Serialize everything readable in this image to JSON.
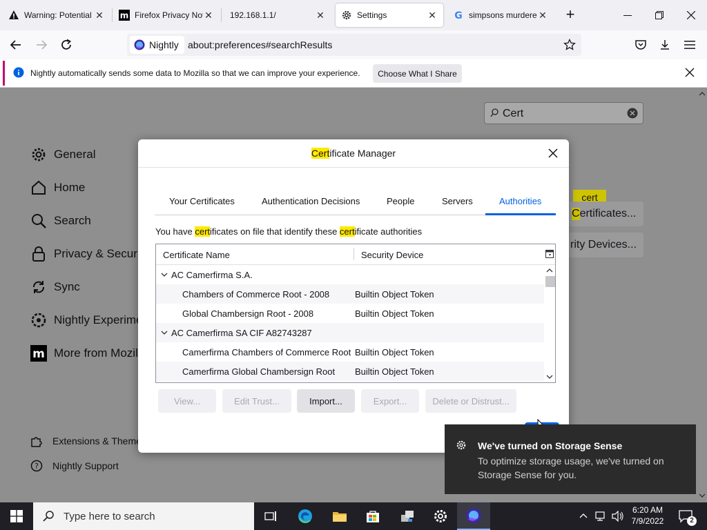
{
  "browser": {
    "tabs": [
      {
        "title": "Warning: Potential",
        "icon": "warning-icon"
      },
      {
        "title": "Firefox Privacy Noti",
        "icon": "mozilla-m-icon"
      },
      {
        "title": "192.168.1.1/",
        "icon": "none"
      },
      {
        "title": "Settings",
        "icon": "gear-icon"
      },
      {
        "title": "simpsons murdered",
        "icon": "google-icon"
      }
    ],
    "new_tab_label": "+",
    "identity_label": "Nightly",
    "url": "about:preferences#searchResults"
  },
  "notification": {
    "message": "Nightly automatically sends some data to Mozilla so that we can improve your experience.",
    "button": "Choose What I Share"
  },
  "settings": {
    "search_value": "Cert",
    "sidebar": [
      {
        "label": "General",
        "icon": "gear-icon"
      },
      {
        "label": "Home",
        "icon": "home-icon"
      },
      {
        "label": "Search",
        "icon": "search-icon"
      },
      {
        "label": "Privacy & Security",
        "icon": "lock-icon"
      },
      {
        "label": "Sync",
        "icon": "sync-icon"
      },
      {
        "label": "Nightly Experime",
        "icon": "experiments-icon"
      },
      {
        "label": "More from Mozill",
        "icon": "mozilla-m-icon"
      }
    ],
    "footer": [
      {
        "label": "Extensions & Theme",
        "icon": "puzzle-icon"
      },
      {
        "label": "Nightly Support",
        "icon": "help-icon"
      }
    ],
    "tooltip": "cert",
    "btn_certificates": "Certificates...",
    "btn_certificates_hl": "C",
    "btn_devices": "rity Devices..."
  },
  "dialog": {
    "title_hl": "Cert",
    "title_rest": "ificate Manager",
    "tabs": [
      "Your Certificates",
      "Authentication Decisions",
      "People",
      "Servers",
      "Authorities"
    ],
    "selected_tab": "Authorities",
    "desc": {
      "p1": "You have ",
      "h1": "cert",
      "p2": "ificates on file that identify these ",
      "h2": "cert",
      "p3": "ificate authorities"
    },
    "columns": [
      "Certificate Name",
      "Security Device"
    ],
    "rows": [
      {
        "type": "group",
        "name": "AC Camerfirma S.A.",
        "device": ""
      },
      {
        "type": "item",
        "name": "Chambers of Commerce Root - 2008",
        "device": "Builtin Object Token"
      },
      {
        "type": "item",
        "name": "Global Chambersign Root - 2008",
        "device": "Builtin Object Token"
      },
      {
        "type": "group",
        "name": "AC Camerfirma SA CIF A82743287",
        "device": ""
      },
      {
        "type": "item",
        "name": "Camerfirma Chambers of Commerce Root",
        "device": "Builtin Object Token"
      },
      {
        "type": "item",
        "name": "Camerfirma Global Chambersign Root",
        "device": "Builtin Object Token"
      }
    ],
    "buttons": {
      "view": "View...",
      "edit_trust": "Edit Trust...",
      "import": "Import...",
      "export": "Export...",
      "delete": "Delete or Distrust..."
    }
  },
  "toast": {
    "title": "We've turned on Storage Sense",
    "body": "To optimize storage usage, we've turned on Storage Sense for you."
  },
  "taskbar": {
    "search_placeholder": "Type here to search",
    "time": "6:20 AM",
    "date": "7/9/2022",
    "notification_count": "2"
  },
  "colors": {
    "accent": "#0061e0",
    "highlight": "#ffe900",
    "notif_bar": "#c4006e"
  }
}
